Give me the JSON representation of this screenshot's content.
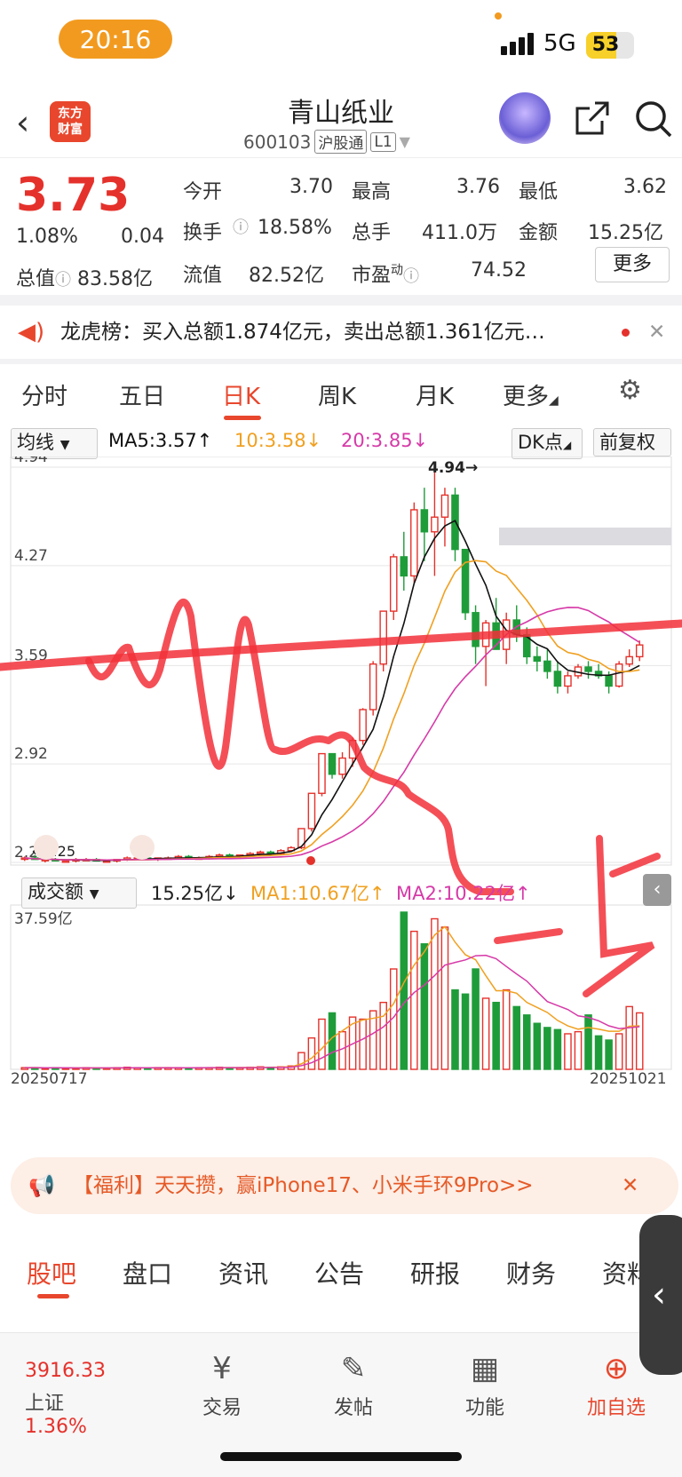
{
  "status": {
    "time": "20:16",
    "network": "5G",
    "battery": "53"
  },
  "header": {
    "back_icon": "chevron-left-icon",
    "logo_text": "东方财富",
    "stock_name": "青山纸业",
    "code": "600103",
    "tag1": "沪股通",
    "tag2": "L1",
    "share_icon": "share-icon",
    "search_icon": "search-icon"
  },
  "quote": {
    "price": "3.73",
    "change_pct": "1.08%",
    "change": "0.04",
    "open_label": "今开",
    "open": "3.70",
    "high_label": "最高",
    "high": "3.76",
    "low_label": "最低",
    "low": "3.62",
    "turnover_label": "换手",
    "turnover": "18.58%",
    "vol_label": "总手",
    "vol": "411.0万",
    "amount_label": "金额",
    "amount": "15.25亿",
    "mcap_label": "总值",
    "mcap": "83.58亿",
    "float_label": "流值",
    "float": "82.52亿",
    "pe_label": "市盈",
    "pe_sup": "动",
    "pe": "74.52",
    "more": "更多"
  },
  "notice": {
    "text": "龙虎榜：买入总额1.874亿元，卖出总额1.361亿元…"
  },
  "tabs": [
    "分时",
    "五日",
    "日K",
    "周K",
    "月K",
    "更多",
    "settings-icon"
  ],
  "ma": {
    "select": "均线",
    "ma5": "MA5:3.57↑",
    "ma10": "10:3.58↓",
    "ma20": "20:3.85↓",
    "dk": "DK点",
    "fq": "前复权"
  },
  "vol_row": {
    "select": "成交额",
    "value": "15.25亿↓",
    "ma1": "MA1:10.67亿↑",
    "ma2": "MA2:10.22亿↑"
  },
  "chart_data": {
    "type": "candlestick",
    "y_ticks": [
      "4.94",
      "4.27",
      "3.59",
      "2.92",
      "2.25"
    ],
    "annot_high": "4.94→",
    "annot_low": "←2.25",
    "vol_max": "37.59亿",
    "date_start": "20250717",
    "date_end": "20251021",
    "candles": [
      [
        2.28,
        2.29,
        2.26,
        2.28
      ],
      [
        2.28,
        2.3,
        2.27,
        2.27
      ],
      [
        2.27,
        2.28,
        2.25,
        2.27
      ],
      [
        2.27,
        2.28,
        2.26,
        2.26
      ],
      [
        2.26,
        2.27,
        2.25,
        2.26
      ],
      [
        2.26,
        2.28,
        2.25,
        2.27
      ],
      [
        2.27,
        2.28,
        2.26,
        2.27
      ],
      [
        2.27,
        2.28,
        2.26,
        2.26
      ],
      [
        2.26,
        2.27,
        2.25,
        2.26
      ],
      [
        2.26,
        2.27,
        2.25,
        2.27
      ],
      [
        2.27,
        2.29,
        2.26,
        2.28
      ],
      [
        2.28,
        2.3,
        2.27,
        2.28
      ],
      [
        2.28,
        2.29,
        2.27,
        2.27
      ],
      [
        2.27,
        2.28,
        2.26,
        2.28
      ],
      [
        2.28,
        2.29,
        2.27,
        2.28
      ],
      [
        2.28,
        2.3,
        2.27,
        2.29
      ],
      [
        2.29,
        2.3,
        2.28,
        2.28
      ],
      [
        2.28,
        2.29,
        2.27,
        2.28
      ],
      [
        2.28,
        2.3,
        2.27,
        2.29
      ],
      [
        2.29,
        2.31,
        2.28,
        2.3
      ],
      [
        2.3,
        2.31,
        2.28,
        2.29
      ],
      [
        2.29,
        2.3,
        2.28,
        2.3
      ],
      [
        2.3,
        2.32,
        2.29,
        2.31
      ],
      [
        2.31,
        2.33,
        2.3,
        2.32
      ],
      [
        2.32,
        2.33,
        2.3,
        2.31
      ],
      [
        2.31,
        2.34,
        2.3,
        2.33
      ],
      [
        2.33,
        2.36,
        2.32,
        2.35
      ],
      [
        2.35,
        2.48,
        2.34,
        2.48
      ],
      [
        2.48,
        2.72,
        2.46,
        2.72
      ],
      [
        2.72,
        2.99,
        2.7,
        2.99
      ],
      [
        2.99,
        2.99,
        2.82,
        2.85
      ],
      [
        2.85,
        3.0,
        2.82,
        2.96
      ],
      [
        2.96,
        3.1,
        2.9,
        3.08
      ],
      [
        3.08,
        3.3,
        3.05,
        3.29
      ],
      [
        3.29,
        3.62,
        3.25,
        3.6
      ],
      [
        3.6,
        3.96,
        3.55,
        3.96
      ],
      [
        3.96,
        4.35,
        3.9,
        4.33
      ],
      [
        4.33,
        4.5,
        4.1,
        4.2
      ],
      [
        4.2,
        4.7,
        4.15,
        4.65
      ],
      [
        4.65,
        4.8,
        4.3,
        4.5
      ],
      [
        4.5,
        4.94,
        4.2,
        4.6
      ],
      [
        4.6,
        4.8,
        4.4,
        4.75
      ],
      [
        4.75,
        4.8,
        4.3,
        4.38
      ],
      [
        4.38,
        4.2,
        3.9,
        3.95
      ],
      [
        3.95,
        4.0,
        3.6,
        3.72
      ],
      [
        3.72,
        3.9,
        3.45,
        3.88
      ],
      [
        3.88,
        4.05,
        3.7,
        3.7
      ],
      [
        3.7,
        3.95,
        3.6,
        3.9
      ],
      [
        3.9,
        4.0,
        3.75,
        3.8
      ],
      [
        3.8,
        3.85,
        3.6,
        3.65
      ],
      [
        3.65,
        3.72,
        3.55,
        3.62
      ],
      [
        3.62,
        3.7,
        3.5,
        3.55
      ],
      [
        3.55,
        3.62,
        3.4,
        3.45
      ],
      [
        3.45,
        3.55,
        3.4,
        3.52
      ],
      [
        3.52,
        3.6,
        3.5,
        3.58
      ],
      [
        3.58,
        3.62,
        3.5,
        3.55
      ],
      [
        3.55,
        3.6,
        3.5,
        3.52
      ],
      [
        3.52,
        3.55,
        3.4,
        3.45
      ],
      [
        3.45,
        3.62,
        3.44,
        3.6
      ],
      [
        3.6,
        3.7,
        3.58,
        3.65
      ],
      [
        3.65,
        3.76,
        3.62,
        3.73
      ]
    ],
    "volumes": [
      0.4,
      0.4,
      0.3,
      0.4,
      0.3,
      0.3,
      0.4,
      0.3,
      0.3,
      0.4,
      0.5,
      0.4,
      0.3,
      0.4,
      0.4,
      0.4,
      0.3,
      0.4,
      0.4,
      0.5,
      0.4,
      0.4,
      0.5,
      0.6,
      0.5,
      0.6,
      0.8,
      4.0,
      7.5,
      12.0,
      13.5,
      9.0,
      12.5,
      12.0,
      14.0,
      16.0,
      24.0,
      37.59,
      33.0,
      30.0,
      36.0,
      34.0,
      19.0,
      18.0,
      24.0,
      17.0,
      16.0,
      19.0,
      15.0,
      13.0,
      11.0,
      10.0,
      9.5,
      8.5,
      9.0,
      13.0,
      8.0,
      7.0,
      8.5,
      15.0,
      13.5
    ]
  },
  "banner": {
    "icon": "megaphone-icon",
    "text": "【福利】天天攒，赢iPhone17、小米手环9Pro>>",
    "close": "✕"
  },
  "bottom_tabs": [
    "股吧",
    "盘口",
    "资讯",
    "公告",
    "研报",
    "财务",
    "资料"
  ],
  "nav": {
    "index_value": "3916.33",
    "index_name": "上证",
    "index_pct": "1.36%",
    "trade": "交易",
    "post": "发帖",
    "func": "功能",
    "add": "加自选"
  },
  "colors": {
    "up": "#e5312b",
    "down": "#1f9c3a",
    "ma5": "#111111",
    "ma10": "#f0a020",
    "ma20": "#d63aa8",
    "accent": "#e8472d"
  }
}
